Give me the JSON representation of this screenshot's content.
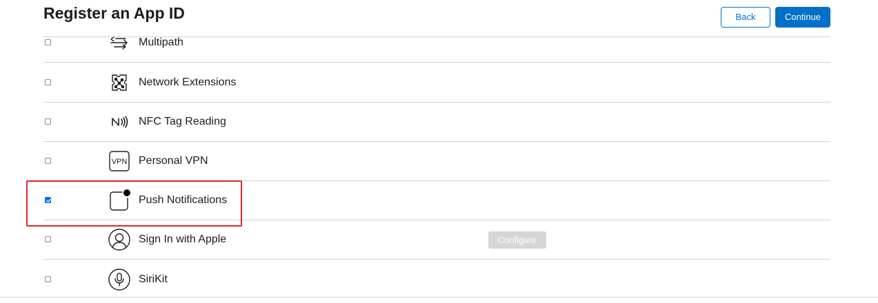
{
  "header": {
    "title": "Register an App ID",
    "back_label": "Back",
    "continue_label": "Continue"
  },
  "capabilities": [
    {
      "label": "Multipath",
      "icon": "multipath-icon",
      "checked": false
    },
    {
      "label": "Network Extensions",
      "icon": "network-extensions-icon",
      "checked": false
    },
    {
      "label": "NFC Tag Reading",
      "icon": "nfc-icon",
      "checked": false
    },
    {
      "label": "Personal VPN",
      "icon": "vpn-icon",
      "checked": false
    },
    {
      "label": "Push Notifications",
      "icon": "push-notifications-icon",
      "checked": true
    },
    {
      "label": "Sign In with Apple",
      "icon": "sign-in-with-apple-icon",
      "checked": false,
      "configure_label": "Configure"
    },
    {
      "label": "SiriKit",
      "icon": "microphone-icon",
      "checked": false
    }
  ],
  "icon_glyphs": {
    "vpn": "VPN"
  },
  "colors": {
    "accent": "#0070c9",
    "highlight": "#e0262a",
    "disabled_button": "#d6d6d6"
  }
}
